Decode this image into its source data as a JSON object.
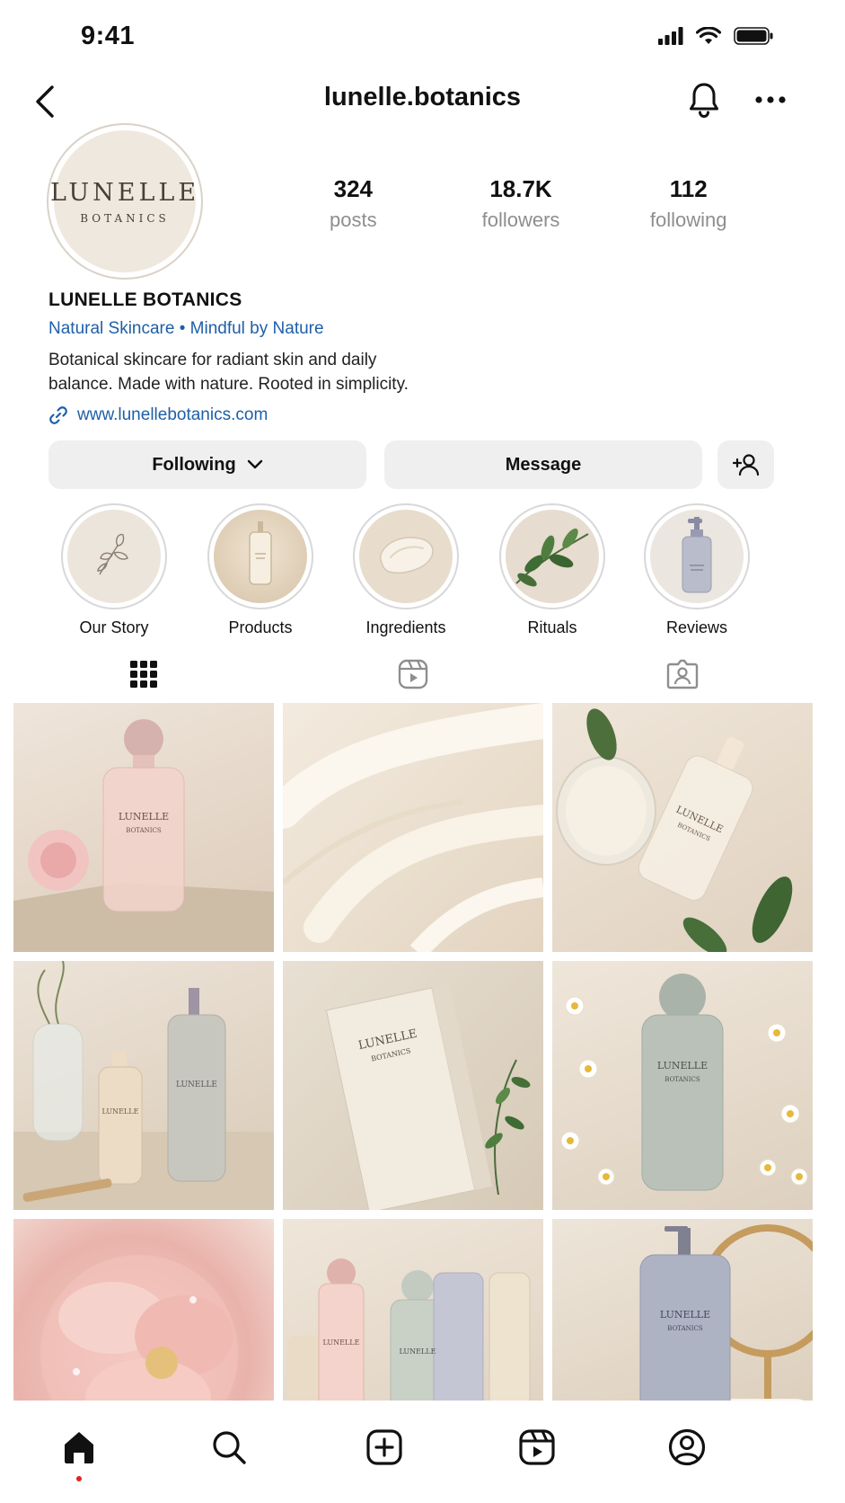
{
  "status_bar": {
    "time": "9:41"
  },
  "header": {
    "username": "lunelle.botanics"
  },
  "profile": {
    "avatar_brand": "LUNELLE",
    "avatar_sub": "BOTANICS",
    "stats": [
      {
        "value": "324",
        "label": "posts"
      },
      {
        "value": "18.7K",
        "label": "followers"
      },
      {
        "value": "112",
        "label": "following"
      }
    ],
    "name": "LUNELLE BOTANICS",
    "category": "Natural Skincare • Mindful by Nature",
    "bio_line1": "Botanical skincare for radiant skin and daily",
    "bio_line2": "balance. Made with nature. Rooted in simplicity.",
    "link": "www.lunellebotanics.com"
  },
  "actions": {
    "following_label": "Following",
    "message_label": "Message"
  },
  "highlights": [
    {
      "label": "Our Story"
    },
    {
      "label": "Products"
    },
    {
      "label": "Ingredients"
    },
    {
      "label": "Rituals"
    },
    {
      "label": "Reviews"
    }
  ],
  "posts": {
    "bottle_brand": "LUNELLE",
    "bottle_sub": "BOTANICS"
  },
  "colors": {
    "link_blue": "#1e5fa8",
    "button_gray": "#efeff0",
    "notification_dot": "#e0241b",
    "cream": "#efe8df"
  }
}
